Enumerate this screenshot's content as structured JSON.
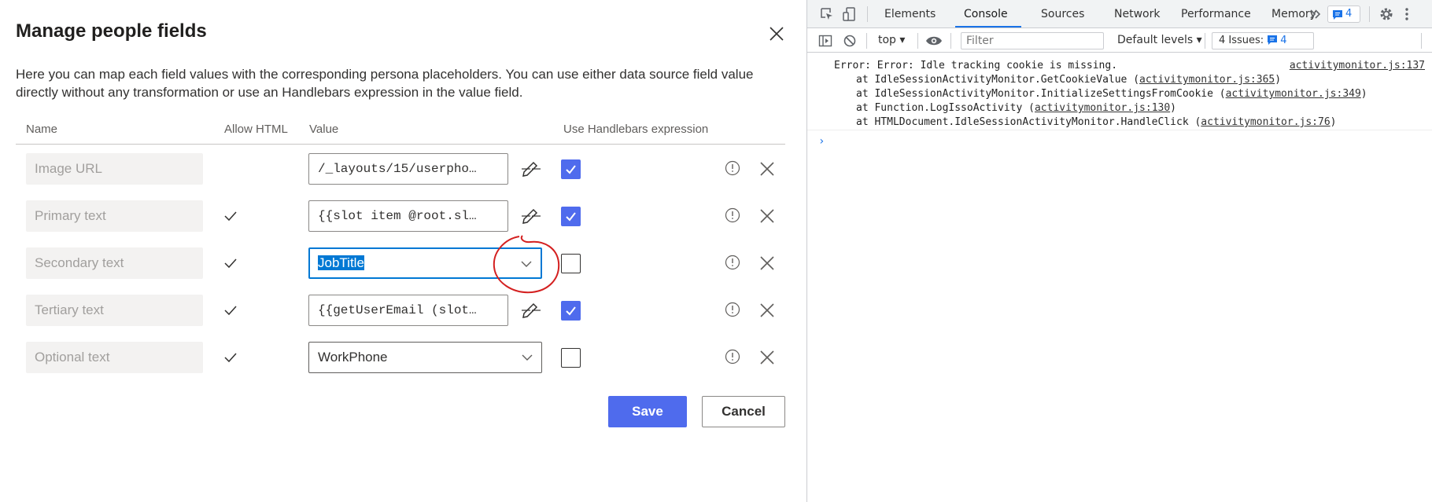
{
  "dialog": {
    "title": "Manage people fields",
    "description": "Here you can map each field values with the corresponding persona placeholders. You can use either data source field value directly without any transformation or use an Handlebars expression in the value field.",
    "headers": {
      "name": "Name",
      "allow_html": "Allow HTML",
      "value": "Value",
      "handlebars": "Use Handlebars expression"
    },
    "rows": [
      {
        "name": "Image URL",
        "allow_html": false,
        "value": "/_layouts/15/userpho…",
        "value_type": "text",
        "handlebars": true
      },
      {
        "name": "Primary text",
        "allow_html": true,
        "value": "{{slot item @root.sl…",
        "value_type": "text",
        "handlebars": true
      },
      {
        "name": "Secondary text",
        "allow_html": true,
        "value": "JobTitle",
        "value_type": "dropdown",
        "handlebars": false
      },
      {
        "name": "Tertiary text",
        "allow_html": true,
        "value": "{{getUserEmail (slot…",
        "value_type": "text",
        "handlebars": true
      },
      {
        "name": "Optional text",
        "allow_html": true,
        "value": "WorkPhone",
        "value_type": "dropdown",
        "handlebars": false
      }
    ],
    "save_label": "Save",
    "cancel_label": "Cancel",
    "accent_color": "#4f6bed"
  },
  "devtools": {
    "tabs": [
      "Elements",
      "Console",
      "Sources",
      "Network",
      "Performance",
      "Memory"
    ],
    "active_tab": "Console",
    "message_badge_count": "4",
    "toolbar": {
      "context": "top",
      "filter_placeholder": "Filter",
      "levels": "Default levels",
      "issues_label": "4 Issues:",
      "issues_count": "4"
    },
    "console": {
      "error_message": "Error: Error: Idle tracking cookie is missing.",
      "error_source": "activitymonitor.js:137",
      "stack": [
        {
          "text": "at IdleSessionActivityMonitor.GetCookieValue (",
          "link": "activitymonitor.js:365",
          "tail": ")"
        },
        {
          "text": "at IdleSessionActivityMonitor.InitializeSettingsFromCookie (",
          "link": "activitymonitor.js:349",
          "tail": ")"
        },
        {
          "text": "at Function.LogIssoActivity (",
          "link": "activitymonitor.js:130",
          "tail": ")"
        },
        {
          "text": "at HTMLDocument.IdleSessionActivityMonitor.HandleClick (",
          "link": "activitymonitor.js:76",
          "tail": ")"
        }
      ],
      "prompt_symbol": "›"
    }
  }
}
